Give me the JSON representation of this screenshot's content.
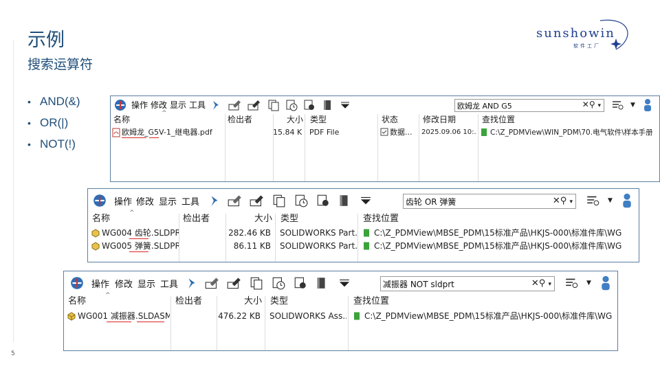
{
  "slide": {
    "title": "示例",
    "subtitle": "搜索运算符",
    "page_number": "5",
    "bullets": [
      "AND(&)",
      "OR(|)",
      "NOT(!)"
    ]
  },
  "logo": {
    "word": "sunshowin",
    "sub": "软件工厂"
  },
  "toolbar": {
    "menus": [
      "操作",
      "修改",
      "显示",
      "工具"
    ]
  },
  "panels": [
    {
      "search_text": "欧姆龙 AND G5",
      "columns": [
        "名称",
        "检出者",
        "大小",
        "类型",
        "状态",
        "修改日期",
        "查找位置"
      ],
      "rows": [
        {
          "name": "欧姆龙_G5V-1_继电器.pdf",
          "checked_out_by": "",
          "size": "15.84 KB",
          "type": "PDF File",
          "state": "数据...",
          "modified": "2025.09.06 10:...",
          "location": "C:\\Z_PDMView\\WIN_PDM\\70.电气软件\\样本手册"
        }
      ]
    },
    {
      "search_text": "齿轮 OR 弹簧",
      "columns": [
        "名称",
        "检出者",
        "大小",
        "类型",
        "查找位置"
      ],
      "rows": [
        {
          "name": "WG004 齿轮.SLDPRT",
          "checked_out_by": "",
          "size": "282.46 KB",
          "type": "SOLIDWORKS Part...",
          "location": "C:\\Z_PDMView\\MBSE_PDM\\15标准产品\\HKJS-000\\标准件库\\WG"
        },
        {
          "name": "WG005 弹簧.SLDPRT",
          "checked_out_by": "",
          "size": "86.11 KB",
          "type": "SOLIDWORKS Part...",
          "location": "C:\\Z_PDMView\\MBSE_PDM\\15标准产品\\HKJS-000\\标准件库\\WG"
        }
      ]
    },
    {
      "search_text": "减振器 NOT sldprt",
      "columns": [
        "名称",
        "检出者",
        "大小",
        "类型",
        "查找位置"
      ],
      "rows": [
        {
          "name": "WG001 减振器.SLDASM",
          "checked_out_by": "",
          "size": "476.22 KB",
          "type": "SOLIDWORKS Ass...",
          "location": "C:\\Z_PDMView\\MBSE_PDM\\15标准产品\\HKJS-000\\标准件库\\WG"
        }
      ]
    }
  ],
  "colors": {
    "title": "#1f4e79",
    "panel_border": "#5a7ea0",
    "underline": "#dd2222",
    "folder_green": "#3aa33a",
    "pdf_red": "#c0392b",
    "sw_yellow": "#e8c34a"
  },
  "icons": [
    "pdm-logo-icon",
    "pin-icon",
    "checkout-icon",
    "checkin-icon",
    "copy-tree-icon",
    "history-icon",
    "view-icon",
    "book-icon",
    "dropdown-icon",
    "clear-icon",
    "search-icon",
    "search-options-icon",
    "user-icon",
    "pdf-file-icon",
    "part-file-icon",
    "assembly-file-icon",
    "folder-icon"
  ]
}
